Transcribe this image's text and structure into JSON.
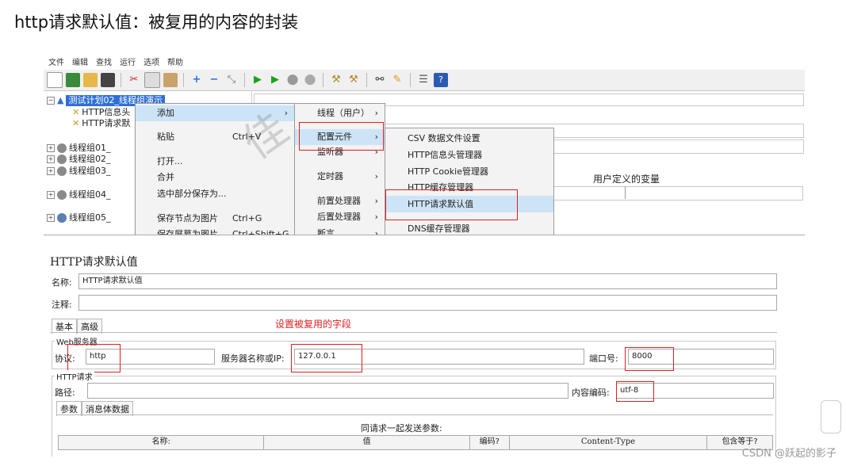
{
  "heading": "http请求默认值：被复用的内容的封装",
  "menubar": [
    "文件",
    "编辑",
    "查找",
    "运行",
    "选项",
    "帮助"
  ],
  "tree": {
    "selected": "测试计划02_线程组演示",
    "children": [
      "HTTP信息头",
      "HTTP请求默"
    ],
    "groups": [
      "线程组01_",
      "线程组02_",
      "线程组03_",
      "线程组04_",
      "线程组05_"
    ]
  },
  "context_menu": {
    "items": [
      {
        "label": "添加",
        "shortcut": ""
      },
      {
        "label": "粘贴",
        "shortcut": "Ctrl+V"
      },
      {
        "label": "打开...",
        "shortcut": ""
      },
      {
        "label": "合并",
        "shortcut": ""
      },
      {
        "label": "选中部分保存为...",
        "shortcut": ""
      },
      {
        "label": "保存节点为图片",
        "shortcut": "Ctrl+G"
      },
      {
        "label": "保存屏幕为图片",
        "shortcut": "Ctrl+Shift+G"
      }
    ]
  },
  "add_submenu": [
    "线程（用户）",
    "配置元件",
    "监听器",
    "定时器",
    "前置处理器",
    "后置处理器",
    "断言"
  ],
  "config_submenu": [
    "CSV 数据文件设置",
    "HTTP信息头管理器",
    "HTTP Cookie管理器",
    "HTTP缓存管理器",
    "HTTP请求默认值",
    "DNS缓存管理器"
  ],
  "right_pane": {
    "user_vars": "用户定义的变量"
  },
  "form": {
    "title": "HTTP请求默认值",
    "name_label": "名称:",
    "name_value": "HTTP请求默认值",
    "comment_label": "注释:",
    "tabs": [
      "基本",
      "高级"
    ],
    "hint": "设置被复用的字段",
    "web_server_title": "Web服务器",
    "protocol_label": "协议:",
    "protocol_value": "http",
    "server_label": "服务器名称或IP:",
    "server_value": "127.0.0.1",
    "port_label": "端口号:",
    "port_value": "8000",
    "http_request_title": "HTTP请求",
    "path_label": "路径:",
    "encoding_label": "内容编码:",
    "encoding_value": "utf-8",
    "param_tabs": [
      "参数",
      "消息体数据"
    ],
    "send_params": "同请求一起发送参数:",
    "columns": [
      "名称:",
      "值",
      "编码?",
      "Content-Type",
      "包含等于?"
    ]
  },
  "watermark": "CSDN @跃起的影子"
}
